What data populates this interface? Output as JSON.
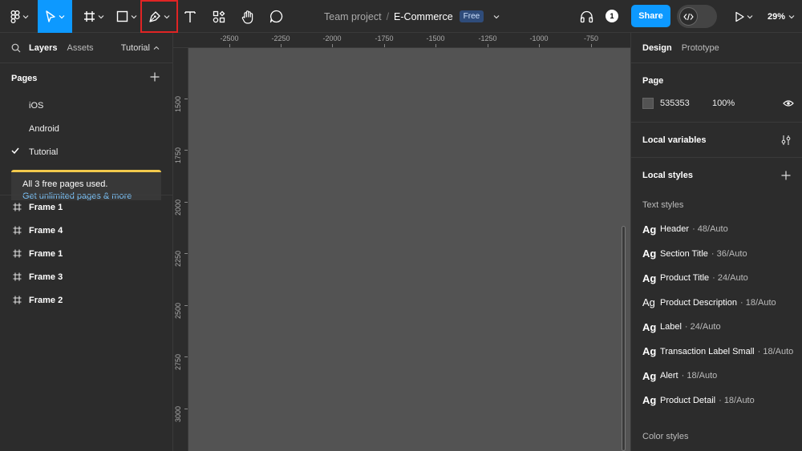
{
  "toolbar": {
    "project": "Team project",
    "separator": "/",
    "file_name": "E-Commerce",
    "plan_badge": "Free",
    "share_label": "Share",
    "avatar_initial": "1",
    "zoom": "29%"
  },
  "left_panel": {
    "tabs": [
      "Layers",
      "Assets"
    ],
    "page_selector": "Tutorial",
    "pages_title": "Pages",
    "pages": [
      {
        "label": "iOS",
        "checked": false
      },
      {
        "label": "Android",
        "checked": false
      },
      {
        "label": "Tutorial",
        "checked": true
      }
    ],
    "notice_line1": "All 3 free pages used.",
    "notice_link": "Get unlimited pages & more",
    "layers": [
      "Frame 1",
      "Frame 4",
      "Frame 1",
      "Frame 3",
      "Frame 2"
    ]
  },
  "rulers": {
    "top": [
      "-2500",
      "-2250",
      "-2000",
      "-1750",
      "-1500",
      "-1250",
      "-1000",
      "-750"
    ],
    "left": [
      "1500",
      "1750",
      "2000",
      "2250",
      "2500",
      "2750",
      "3000"
    ]
  },
  "right_panel": {
    "tabs": [
      "Design",
      "Prototype"
    ],
    "page_section_title": "Page",
    "page_color": "535353",
    "page_opacity": "100%",
    "local_variables": "Local variables",
    "local_styles": "Local styles",
    "text_styles_title": "Text styles",
    "text_styles": [
      {
        "name": "Header",
        "meta": "· 48/Auto",
        "bold": true
      },
      {
        "name": "Section Title",
        "meta": "· 36/Auto",
        "bold": true
      },
      {
        "name": "Product Title",
        "meta": "· 24/Auto",
        "bold": true
      },
      {
        "name": "Product Description",
        "meta": "· 18/Auto",
        "bold": false
      },
      {
        "name": "Label",
        "meta": "· 24/Auto",
        "bold": true
      },
      {
        "name": "Transaction Label Small",
        "meta": "· 18/Auto",
        "bold": true
      },
      {
        "name": "Alert",
        "meta": "· 18/Auto",
        "bold": true
      },
      {
        "name": "Product Detail",
        "meta": "· 18/Auto",
        "bold": true
      }
    ],
    "color_styles_title": "Color styles"
  },
  "colors": {
    "accent": "#0d99ff",
    "canvas": "#535353",
    "panel": "#2c2c2c",
    "highlight_outline": "#e02424",
    "notice_bar": "#f2c94c"
  }
}
